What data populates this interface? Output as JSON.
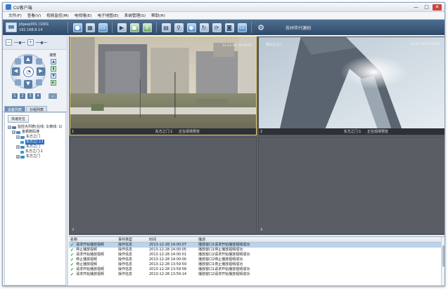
{
  "window": {
    "title": "CU客户端",
    "minimize": "—",
    "maximize": "□",
    "close": "✕"
  },
  "menu": [
    "文件(F)",
    "查看(V)",
    "视频监控(M)",
    "电视墙(E)",
    "电子地图(E)",
    "系统管理(S)",
    "帮助(H)"
  ],
  "user": {
    "name": "jdgasp001 (1001",
    "ip": "192.168.8.14"
  },
  "toolbar": {
    "caption": "苏州华兴源创"
  },
  "ptz": {
    "speed_label": "速度",
    "presets": [
      "1",
      "2",
      "3",
      "4"
    ]
  },
  "tabs": [
    "设备列表",
    "分组列表"
  ],
  "tree": {
    "quick_button": "快速定位",
    "nodes": [
      {
        "level": 0,
        "text": "监控点列表(在线: 3/离线: 1)",
        "type": "root",
        "toggle": "⊟",
        "selected": false
      },
      {
        "level": 1,
        "text": "金枫数码港",
        "type": "group",
        "toggle": "⊟",
        "selected": false
      },
      {
        "level": 2,
        "text": "东方之门",
        "type": "device",
        "toggle": "⊟",
        "selected": false
      },
      {
        "level": 3,
        "text": "东方之门:1",
        "type": "camera",
        "toggle": "",
        "selected": true
      },
      {
        "level": 2,
        "text": "东方之门",
        "type": "device",
        "toggle": "⊟",
        "selected": false
      },
      {
        "level": 3,
        "text": "东方之门:1",
        "type": "camera",
        "toggle": "",
        "selected": false
      },
      {
        "level": 2,
        "text": "东方之门",
        "type": "device",
        "toggle": "⊞",
        "selected": false
      }
    ]
  },
  "video": {
    "cells": [
      {
        "num": "1",
        "name": "东方之门:1",
        "status": "正在现场预览",
        "osd_left": "",
        "osd_right": "13-12-28 14:04:07"
      },
      {
        "num": "2",
        "name": "东方之门:1",
        "status": "正在现场预览",
        "osd_left": "南东方之门",
        "osd_right": "13-12-28 14:04:07"
      },
      {
        "num": "3",
        "name": "",
        "status": "",
        "osd_left": "",
        "osd_right": ""
      },
      {
        "num": "4",
        "name": "",
        "status": "",
        "osd_left": "",
        "osd_right": ""
      }
    ]
  },
  "log": {
    "headers": [
      "名称",
      "事件类型",
      "时间",
      "描述"
    ],
    "rows": [
      {
        "name": "请求开始播放视频",
        "type": "操作信息",
        "time": "2013-12-28 14:00:07",
        "desc": "播放窗口1请求开始播放视频成功",
        "selected": true
      },
      {
        "name": "停止播放视频",
        "type": "操作信息",
        "time": "2013-12-28 14:00:05",
        "desc": "播放窗口1停止播放视频成功",
        "selected": false
      },
      {
        "name": "请求开始播放视频",
        "type": "操作信息",
        "time": "2013-12-28 14:00:01",
        "desc": "播放窗口2请求开始播放视频成功",
        "selected": false
      },
      {
        "name": "停止播放视频",
        "type": "操作信息",
        "time": "2013-12-28 14:00:00",
        "desc": "播放窗口2停止播放视频成功",
        "selected": false
      },
      {
        "name": "停止播放视频",
        "type": "操作信息",
        "time": "2013-12-28 13:59:59",
        "desc": "播放窗口1停止播放视频成功",
        "selected": false
      },
      {
        "name": "请求开始播放视频",
        "type": "操作信息",
        "time": "2013-12-28 13:59:58",
        "desc": "播放窗口1请求开始播放视频成功",
        "selected": false
      },
      {
        "name": "请求开始播放视频",
        "type": "操作信息",
        "time": "2013-12-28 13:59:14",
        "desc": "播放窗口2请求开始播放视频成功",
        "selected": false
      }
    ]
  }
}
